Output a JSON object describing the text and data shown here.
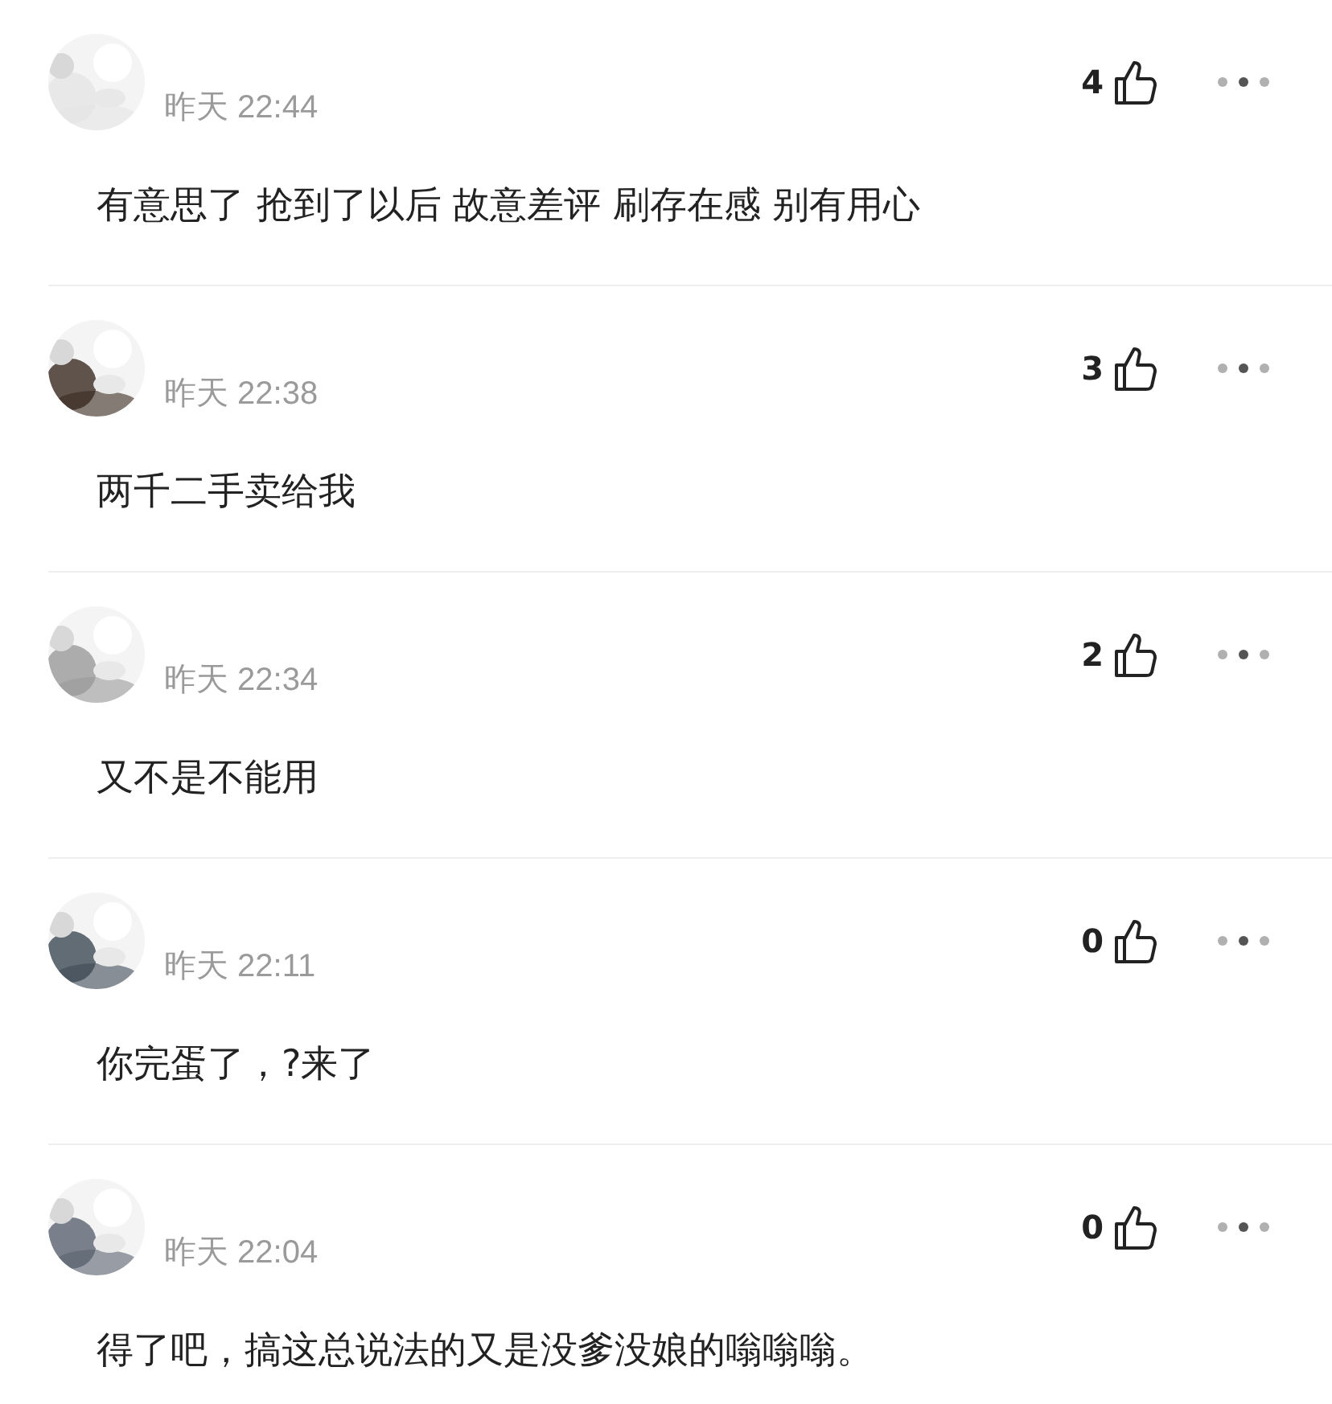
{
  "comments": [
    {
      "time": "昨天 22:44",
      "likes": "4",
      "text": "有意思了 抢到了以后 故意差评 刷存在感 别有用心"
    },
    {
      "time": "昨天 22:38",
      "likes": "3",
      "text": "两千二手卖给我"
    },
    {
      "time": "昨天 22:34",
      "likes": "2",
      "text": "又不是不能用"
    },
    {
      "time": "昨天 22:11",
      "likes": "0",
      "text": "你完蛋了，?来了"
    },
    {
      "time": "昨天 22:04",
      "likes": "0",
      "text": "得了吧，搞这总说法的又是没爹没娘的嗡嗡嗡。"
    }
  ]
}
